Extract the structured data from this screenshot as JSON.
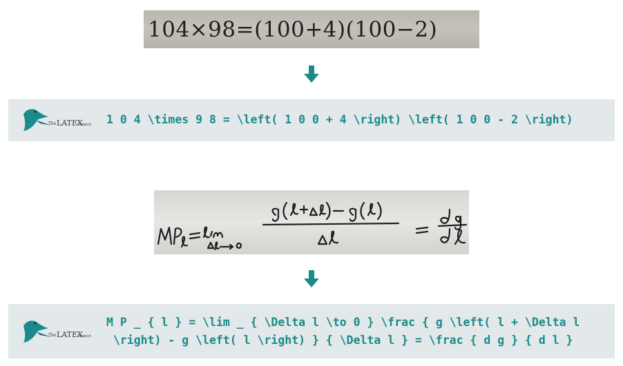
{
  "examples": [
    {
      "input_text": "104×98=(100+4)(100−2)",
      "output_latex": "1 0 4 \\times 9 8 = \\left( 1 0 0 + 4 \\right) \\left( 1 0 0 - 2 \\right)"
    },
    {
      "input_text": "",
      "output_latex_line1": "M P _ { l } = \\lim _ { \\Delta l \\to 0 } \\frac { g \\left( l + \\Delta l",
      "output_latex_line2": "\\right) - g \\left( l \\right) } { \\Delta l } = \\frac { d g } { d l }"
    }
  ],
  "logo": {
    "small_text": "The",
    "brand": "LATEX",
    "project": "Project"
  },
  "colors": {
    "accent": "#1b8a8a",
    "band": "#e3e8ea",
    "ink": "#1e1e1e"
  }
}
